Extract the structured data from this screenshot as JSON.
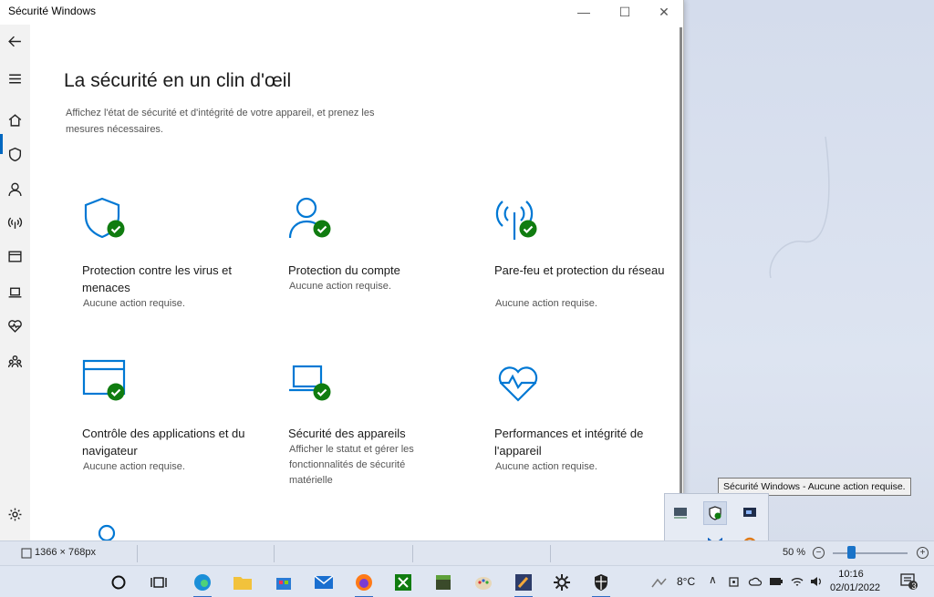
{
  "window": {
    "title": "Sécurité Windows",
    "minimize": "—",
    "maximize": "☐",
    "close": "✕"
  },
  "nav": {
    "items": [
      "back",
      "menu",
      "home",
      "shield",
      "account",
      "network",
      "app-browser",
      "device",
      "health",
      "family"
    ],
    "settings": "settings"
  },
  "main": {
    "heading": "La sécurité en un clin d'œil",
    "subtitle": "Affichez l'état de sécurité et d'intégrité de votre appareil, et prenez les mesures nécessaires.",
    "tiles": [
      {
        "title": "Protection contre les virus et menaces",
        "status": "Aucune action requise.",
        "icon": "shield-icon"
      },
      {
        "title": "Protection du compte",
        "status": "Aucune action requise.",
        "icon": "person-icon"
      },
      {
        "title": "Pare-feu et protection du réseau",
        "status": "Aucune action requise.",
        "icon": "antenna-icon"
      },
      {
        "title": "Contrôle des applications et du navigateur",
        "status": "Aucune action requise.",
        "icon": "browser-window-icon"
      },
      {
        "title": "Sécurité des appareils",
        "status": "Afficher le statut et gérer les fonctionnalités de sécurité matérielle",
        "icon": "laptop-icon"
      },
      {
        "title": "Performances et intégrité de l'appareil",
        "status": "Aucune action requise.",
        "icon": "heart-pulse-icon"
      }
    ]
  },
  "tooltip": "Sécurité Windows - Aucune action requise.",
  "statusbar": {
    "resolution": "1366 × 768px",
    "zoom": "50 %",
    "zoom_minus": "−",
    "zoom_plus": "+",
    "zoom_level": 0.5
  },
  "taskbar": {
    "weather": "8°C",
    "time": "10:16",
    "date": "02/01/2022",
    "notifications": "3"
  },
  "colors": {
    "accent": "#0067c0",
    "ok_green": "#107c10",
    "icon_blue": "#0078d4"
  }
}
